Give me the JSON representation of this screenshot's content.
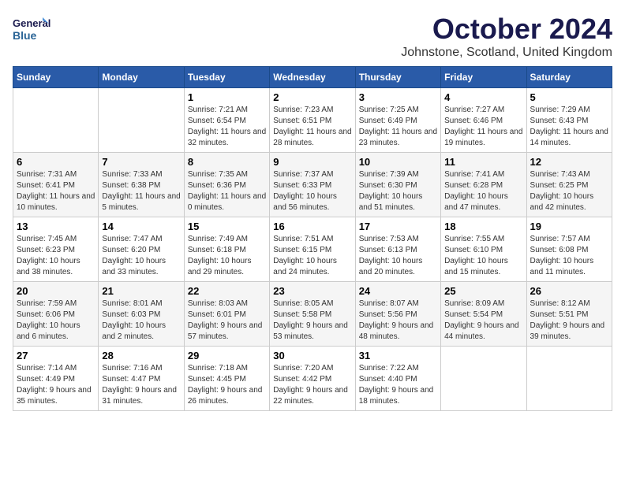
{
  "header": {
    "logo_line1": "General",
    "logo_line2": "Blue",
    "month_title": "October 2024",
    "location": "Johnstone, Scotland, United Kingdom"
  },
  "days_of_week": [
    "Sunday",
    "Monday",
    "Tuesday",
    "Wednesday",
    "Thursday",
    "Friday",
    "Saturday"
  ],
  "weeks": [
    [
      {
        "day": "",
        "sunrise": "",
        "sunset": "",
        "daylight": ""
      },
      {
        "day": "",
        "sunrise": "",
        "sunset": "",
        "daylight": ""
      },
      {
        "day": "1",
        "sunrise": "Sunrise: 7:21 AM",
        "sunset": "Sunset: 6:54 PM",
        "daylight": "Daylight: 11 hours and 32 minutes."
      },
      {
        "day": "2",
        "sunrise": "Sunrise: 7:23 AM",
        "sunset": "Sunset: 6:51 PM",
        "daylight": "Daylight: 11 hours and 28 minutes."
      },
      {
        "day": "3",
        "sunrise": "Sunrise: 7:25 AM",
        "sunset": "Sunset: 6:49 PM",
        "daylight": "Daylight: 11 hours and 23 minutes."
      },
      {
        "day": "4",
        "sunrise": "Sunrise: 7:27 AM",
        "sunset": "Sunset: 6:46 PM",
        "daylight": "Daylight: 11 hours and 19 minutes."
      },
      {
        "day": "5",
        "sunrise": "Sunrise: 7:29 AM",
        "sunset": "Sunset: 6:43 PM",
        "daylight": "Daylight: 11 hours and 14 minutes."
      }
    ],
    [
      {
        "day": "6",
        "sunrise": "Sunrise: 7:31 AM",
        "sunset": "Sunset: 6:41 PM",
        "daylight": "Daylight: 11 hours and 10 minutes."
      },
      {
        "day": "7",
        "sunrise": "Sunrise: 7:33 AM",
        "sunset": "Sunset: 6:38 PM",
        "daylight": "Daylight: 11 hours and 5 minutes."
      },
      {
        "day": "8",
        "sunrise": "Sunrise: 7:35 AM",
        "sunset": "Sunset: 6:36 PM",
        "daylight": "Daylight: 11 hours and 0 minutes."
      },
      {
        "day": "9",
        "sunrise": "Sunrise: 7:37 AM",
        "sunset": "Sunset: 6:33 PM",
        "daylight": "Daylight: 10 hours and 56 minutes."
      },
      {
        "day": "10",
        "sunrise": "Sunrise: 7:39 AM",
        "sunset": "Sunset: 6:30 PM",
        "daylight": "Daylight: 10 hours and 51 minutes."
      },
      {
        "day": "11",
        "sunrise": "Sunrise: 7:41 AM",
        "sunset": "Sunset: 6:28 PM",
        "daylight": "Daylight: 10 hours and 47 minutes."
      },
      {
        "day": "12",
        "sunrise": "Sunrise: 7:43 AM",
        "sunset": "Sunset: 6:25 PM",
        "daylight": "Daylight: 10 hours and 42 minutes."
      }
    ],
    [
      {
        "day": "13",
        "sunrise": "Sunrise: 7:45 AM",
        "sunset": "Sunset: 6:23 PM",
        "daylight": "Daylight: 10 hours and 38 minutes."
      },
      {
        "day": "14",
        "sunrise": "Sunrise: 7:47 AM",
        "sunset": "Sunset: 6:20 PM",
        "daylight": "Daylight: 10 hours and 33 minutes."
      },
      {
        "day": "15",
        "sunrise": "Sunrise: 7:49 AM",
        "sunset": "Sunset: 6:18 PM",
        "daylight": "Daylight: 10 hours and 29 minutes."
      },
      {
        "day": "16",
        "sunrise": "Sunrise: 7:51 AM",
        "sunset": "Sunset: 6:15 PM",
        "daylight": "Daylight: 10 hours and 24 minutes."
      },
      {
        "day": "17",
        "sunrise": "Sunrise: 7:53 AM",
        "sunset": "Sunset: 6:13 PM",
        "daylight": "Daylight: 10 hours and 20 minutes."
      },
      {
        "day": "18",
        "sunrise": "Sunrise: 7:55 AM",
        "sunset": "Sunset: 6:10 PM",
        "daylight": "Daylight: 10 hours and 15 minutes."
      },
      {
        "day": "19",
        "sunrise": "Sunrise: 7:57 AM",
        "sunset": "Sunset: 6:08 PM",
        "daylight": "Daylight: 10 hours and 11 minutes."
      }
    ],
    [
      {
        "day": "20",
        "sunrise": "Sunrise: 7:59 AM",
        "sunset": "Sunset: 6:06 PM",
        "daylight": "Daylight: 10 hours and 6 minutes."
      },
      {
        "day": "21",
        "sunrise": "Sunrise: 8:01 AM",
        "sunset": "Sunset: 6:03 PM",
        "daylight": "Daylight: 10 hours and 2 minutes."
      },
      {
        "day": "22",
        "sunrise": "Sunrise: 8:03 AM",
        "sunset": "Sunset: 6:01 PM",
        "daylight": "Daylight: 9 hours and 57 minutes."
      },
      {
        "day": "23",
        "sunrise": "Sunrise: 8:05 AM",
        "sunset": "Sunset: 5:58 PM",
        "daylight": "Daylight: 9 hours and 53 minutes."
      },
      {
        "day": "24",
        "sunrise": "Sunrise: 8:07 AM",
        "sunset": "Sunset: 5:56 PM",
        "daylight": "Daylight: 9 hours and 48 minutes."
      },
      {
        "day": "25",
        "sunrise": "Sunrise: 8:09 AM",
        "sunset": "Sunset: 5:54 PM",
        "daylight": "Daylight: 9 hours and 44 minutes."
      },
      {
        "day": "26",
        "sunrise": "Sunrise: 8:12 AM",
        "sunset": "Sunset: 5:51 PM",
        "daylight": "Daylight: 9 hours and 39 minutes."
      }
    ],
    [
      {
        "day": "27",
        "sunrise": "Sunrise: 7:14 AM",
        "sunset": "Sunset: 4:49 PM",
        "daylight": "Daylight: 9 hours and 35 minutes."
      },
      {
        "day": "28",
        "sunrise": "Sunrise: 7:16 AM",
        "sunset": "Sunset: 4:47 PM",
        "daylight": "Daylight: 9 hours and 31 minutes."
      },
      {
        "day": "29",
        "sunrise": "Sunrise: 7:18 AM",
        "sunset": "Sunset: 4:45 PM",
        "daylight": "Daylight: 9 hours and 26 minutes."
      },
      {
        "day": "30",
        "sunrise": "Sunrise: 7:20 AM",
        "sunset": "Sunset: 4:42 PM",
        "daylight": "Daylight: 9 hours and 22 minutes."
      },
      {
        "day": "31",
        "sunrise": "Sunrise: 7:22 AM",
        "sunset": "Sunset: 4:40 PM",
        "daylight": "Daylight: 9 hours and 18 minutes."
      },
      {
        "day": "",
        "sunrise": "",
        "sunset": "",
        "daylight": ""
      },
      {
        "day": "",
        "sunrise": "",
        "sunset": "",
        "daylight": ""
      }
    ]
  ]
}
